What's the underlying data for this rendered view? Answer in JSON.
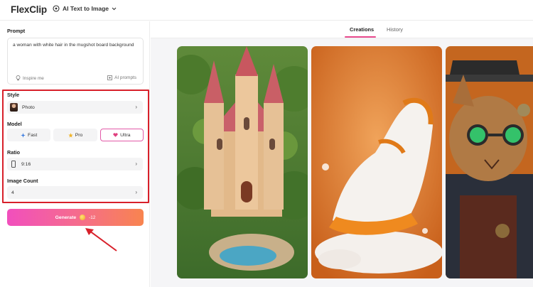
{
  "header": {
    "logo_text": "FlexClip",
    "tool_label": "AI Text to Image"
  },
  "prompt": {
    "label": "Prompt",
    "value": "a woman with white hair in the mugshot board background",
    "inspire_label": "Inspire me",
    "ai_prompts_label": "AI prompts"
  },
  "style": {
    "label": "Style",
    "value": "Photo"
  },
  "model": {
    "label": "Model",
    "options": [
      "Fast",
      "Pro",
      "Ultra"
    ],
    "selected": "Ultra"
  },
  "ratio": {
    "label": "Ratio",
    "value": "9:16"
  },
  "image_count": {
    "label": "Image Count",
    "value": "4"
  },
  "generate": {
    "label": "Generate",
    "credits": "-12"
  },
  "tabs": {
    "creations": "Creations",
    "history": "History",
    "active": "Creations"
  },
  "gallery": [
    {
      "subject": "fairy-tale castle"
    },
    {
      "subject": "orange sneaker"
    },
    {
      "subject": "steampunk cat"
    }
  ],
  "colors": {
    "accent": "#e84a8e",
    "highlight_frame": "#d8202a",
    "generate_start": "#f14fbd",
    "generate_end": "#f8844f"
  }
}
